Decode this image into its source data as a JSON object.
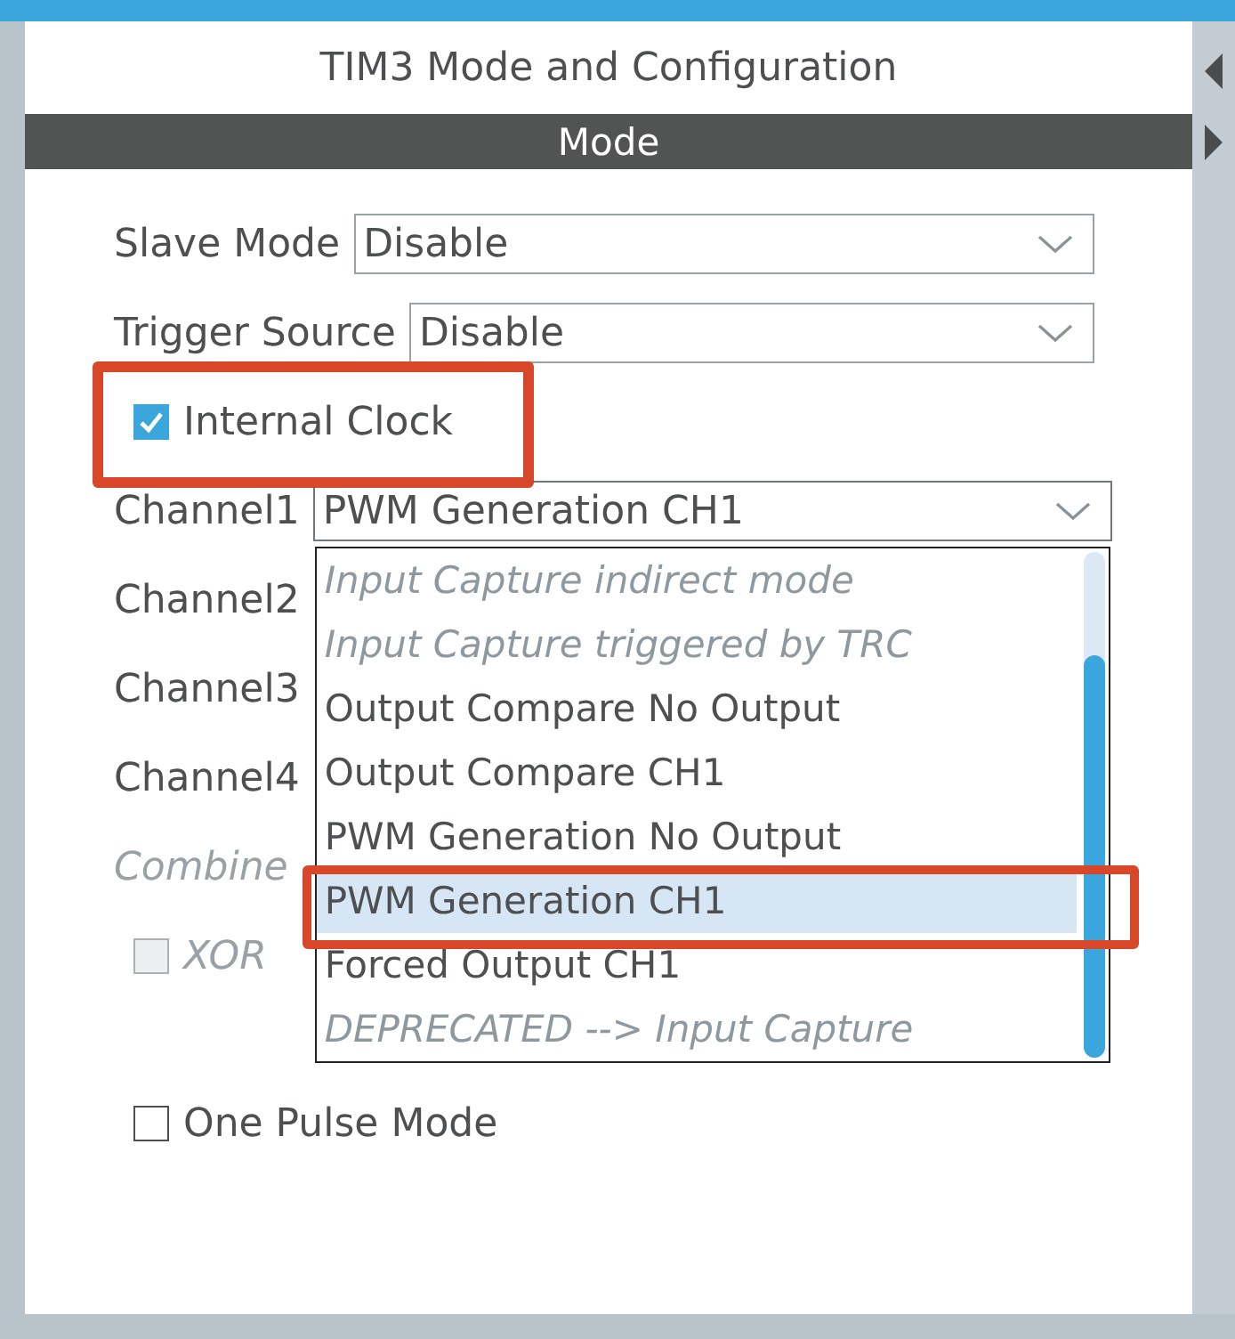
{
  "title": "TIM3 Mode and Configuration",
  "section": "Mode",
  "fields": [
    {
      "label": "Slave Mode",
      "value": "Disable"
    },
    {
      "label": "Trigger Source",
      "value": "Disable"
    }
  ],
  "internal_clock": {
    "label": "Internal Clock",
    "checked": true
  },
  "channels": [
    {
      "label": "Channel1",
      "value": "PWM Generation CH1",
      "expanded": true
    },
    {
      "label": "Channel2"
    },
    {
      "label": "Channel3"
    },
    {
      "label": "Channel4"
    }
  ],
  "combined": {
    "label": "Combine",
    "disabled": true
  },
  "xor": {
    "label": "XOR",
    "checked": false,
    "disabled": true
  },
  "one_pulse": {
    "label": "One Pulse Mode",
    "checked": false,
    "disabled": false
  },
  "options": [
    {
      "label": "Input Capture indirect mode",
      "disabled": true,
      "selected": false
    },
    {
      "label": "Input Capture triggered by TRC",
      "disabled": true,
      "selected": false
    },
    {
      "label": "Output Compare No Output",
      "disabled": false,
      "selected": false
    },
    {
      "label": "Output Compare CH1",
      "disabled": false,
      "selected": false
    },
    {
      "label": "PWM Generation No Output",
      "disabled": false,
      "selected": false
    },
    {
      "label": "PWM Generation CH1",
      "disabled": false,
      "selected": true
    },
    {
      "label": "Forced Output CH1",
      "disabled": false,
      "selected": false
    },
    {
      "label": "DEPRECATED --> Input Capture",
      "disabled": true,
      "selected": false
    }
  ]
}
